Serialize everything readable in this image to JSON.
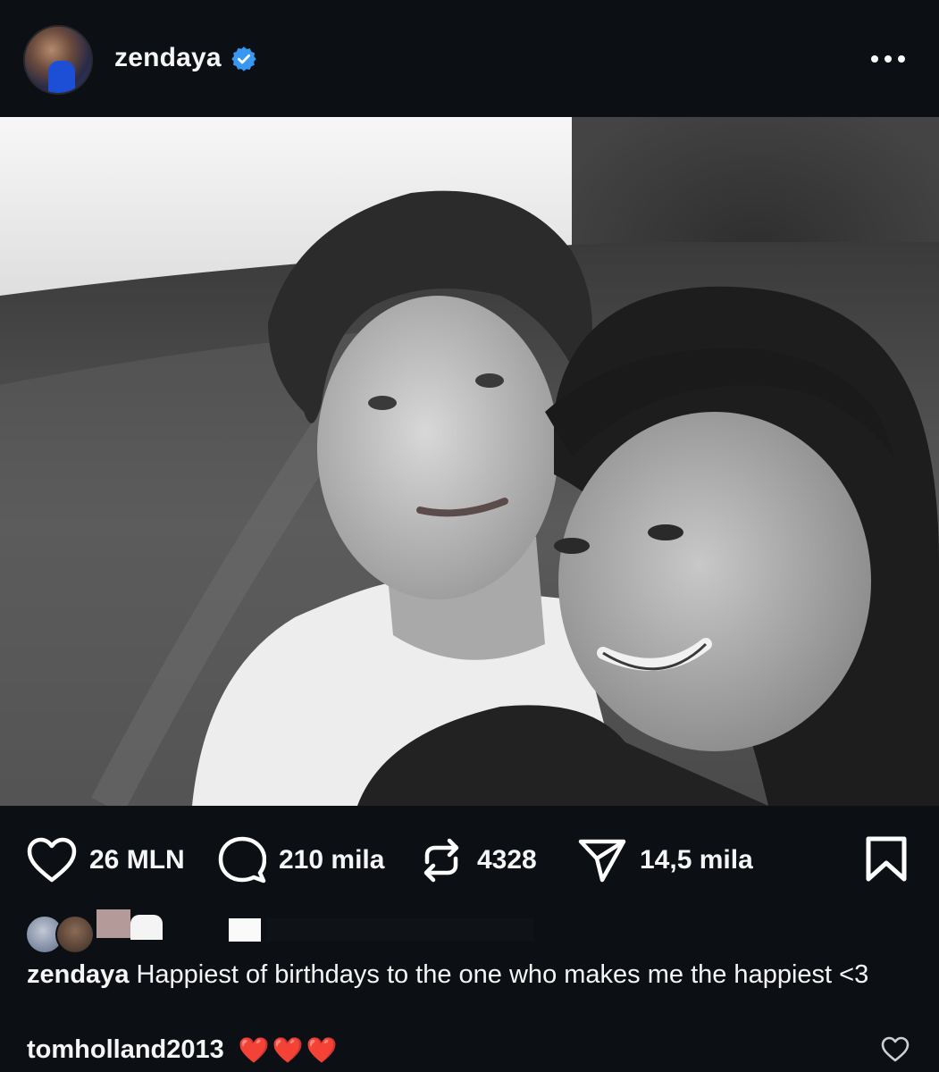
{
  "post": {
    "author": "zendaya",
    "verified": true
  },
  "stats": {
    "likes": "26 MLN",
    "comments": "210 mila",
    "reposts": "4328",
    "shares": "14,5 mila"
  },
  "caption": {
    "username": "zendaya",
    "text": "Happiest of birthdays to the one who makes me the happiest <3"
  },
  "top_comment": {
    "username": "tomholland2013",
    "text": "❤️❤️❤️"
  },
  "colors": {
    "background": "#0c0f14",
    "verified": "#3897f0",
    "heart": "#e0162b"
  },
  "icons": [
    "verified-badge-icon",
    "more-icon",
    "heart-icon",
    "comment-icon",
    "repost-icon",
    "share-icon",
    "bookmark-icon"
  ]
}
